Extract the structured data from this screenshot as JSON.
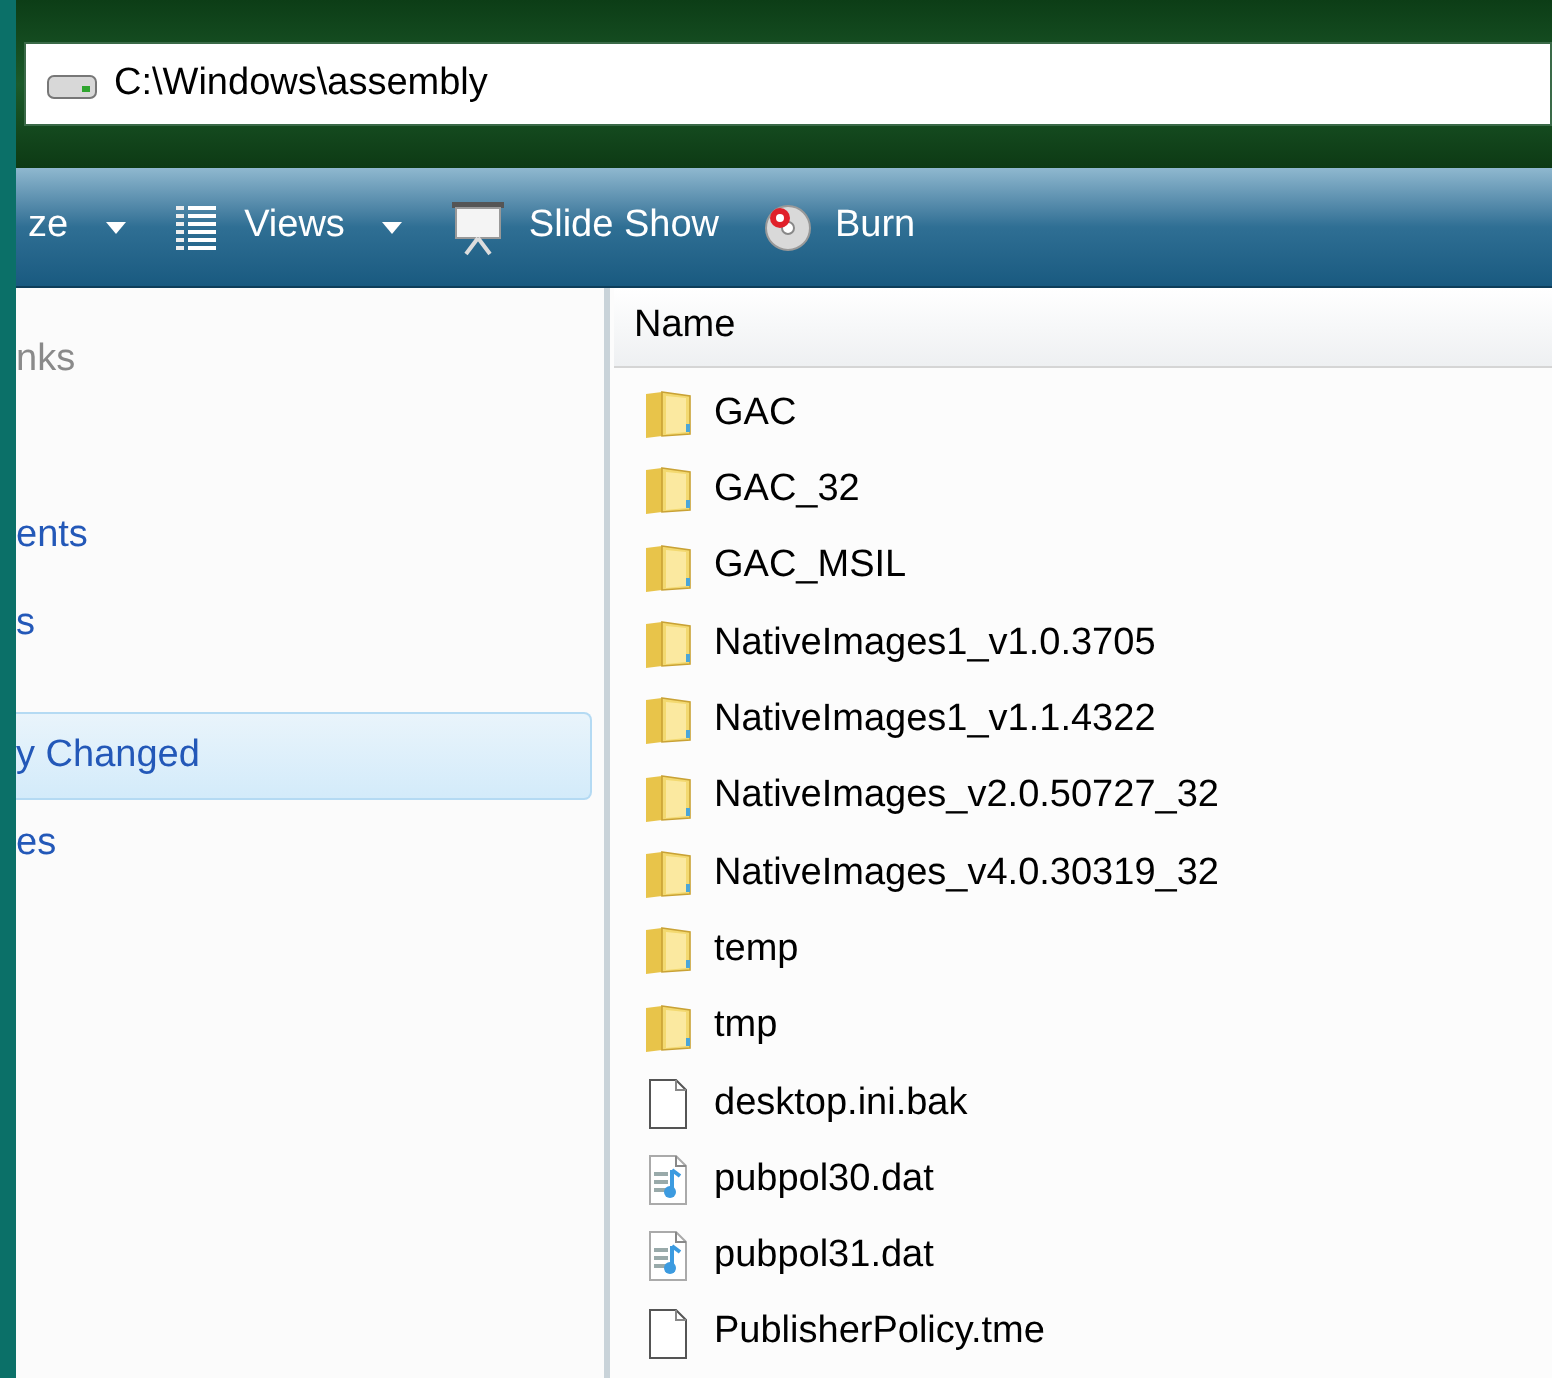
{
  "address_bar": {
    "path": "C:\\Windows\\assembly"
  },
  "toolbar": [
    {
      "kind": "dropdown",
      "label": "ze"
    },
    {
      "kind": "views",
      "label": "Views"
    },
    {
      "kind": "slideshow",
      "label": "Slide Show"
    },
    {
      "kind": "burn",
      "label": "Burn"
    }
  ],
  "sidebar": {
    "heading": "nks",
    "items": [
      {
        "label": "ents",
        "selected": false
      },
      {
        "label": "s",
        "selected": false
      },
      {
        "label": "y Changed",
        "selected": true
      },
      {
        "label": "es",
        "selected": false
      }
    ]
  },
  "file_list": {
    "columns": [
      "Name"
    ],
    "rows": [
      {
        "kind": "folder",
        "name": "GAC"
      },
      {
        "kind": "folder",
        "name": "GAC_32"
      },
      {
        "kind": "folder",
        "name": "GAC_MSIL"
      },
      {
        "kind": "folder",
        "name": "NativeImages1_v1.0.3705"
      },
      {
        "kind": "folder",
        "name": "NativeImages1_v1.1.4322"
      },
      {
        "kind": "folder",
        "name": "NativeImages_v2.0.50727_32"
      },
      {
        "kind": "folder",
        "name": "NativeImages_v4.0.30319_32"
      },
      {
        "kind": "folder",
        "name": "temp"
      },
      {
        "kind": "folder",
        "name": "tmp"
      },
      {
        "kind": "file",
        "name": "desktop.ini.bak"
      },
      {
        "kind": "media",
        "name": "pubpol30.dat"
      },
      {
        "kind": "media",
        "name": "pubpol31.dat"
      },
      {
        "kind": "file",
        "name": "PublisherPolicy.tme"
      }
    ]
  }
}
